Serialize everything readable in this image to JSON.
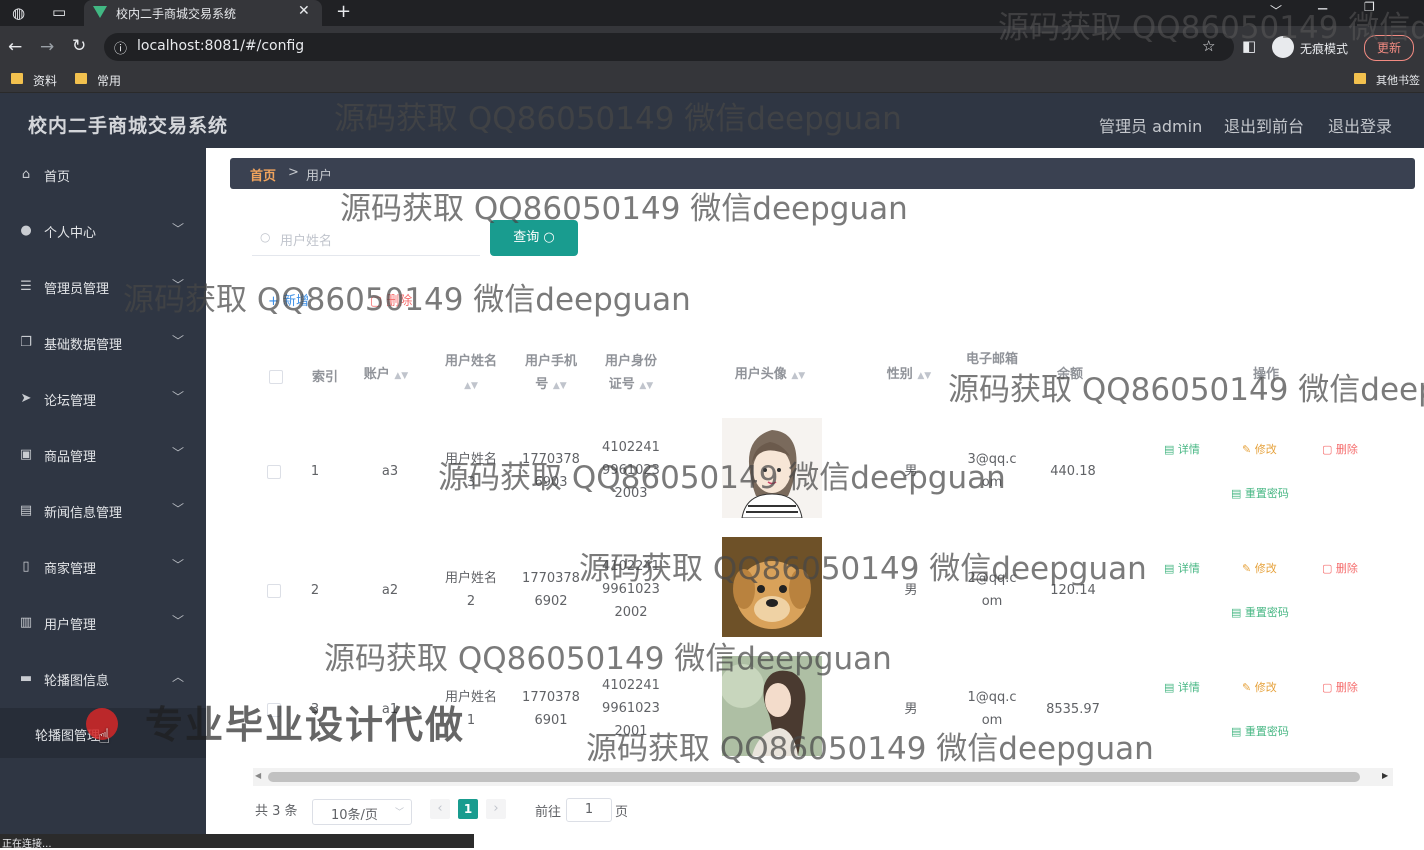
{
  "browser": {
    "tab_title": "校内二手商城交易系统",
    "url": "localhost:8081/#/config",
    "incognito_label": "无痕模式",
    "update_label": "更新",
    "bookmarks": [
      "资料",
      "常用"
    ],
    "other_bookmarks": "其他书签",
    "status_text": "正在连接..."
  },
  "app": {
    "title": "校内二手商城交易系统",
    "admin_label": "管理员 admin",
    "to_front_label": "退出到前台",
    "logout_label": "退出登录"
  },
  "sidebar": {
    "items": [
      {
        "label": "首页",
        "icon": "home-icon"
      },
      {
        "label": "个人中心",
        "icon": "user-icon",
        "arrow": "﹀"
      },
      {
        "label": "管理员管理",
        "icon": "list-icon",
        "arrow": "﹀"
      },
      {
        "label": "基础数据管理",
        "icon": "copy-icon",
        "arrow": "﹀"
      },
      {
        "label": "论坛管理",
        "icon": "send-icon",
        "arrow": "﹀"
      },
      {
        "label": "商品管理",
        "icon": "goods-icon",
        "arrow": "﹀"
      },
      {
        "label": "新闻信息管理",
        "icon": "news-icon",
        "arrow": "﹀"
      },
      {
        "label": "商家管理",
        "icon": "shop-icon",
        "arrow": "﹀"
      },
      {
        "label": "用户管理",
        "icon": "chart-icon",
        "arrow": "﹀"
      },
      {
        "label": "轮播图信息",
        "icon": "carousel-icon",
        "arrow": "︿"
      }
    ],
    "submenu_label": "轮播图管理"
  },
  "breadcrumb": {
    "home": "首页",
    "separator": ">",
    "current": "用户"
  },
  "search": {
    "placeholder": "用户姓名",
    "button_label": "查询"
  },
  "actions": {
    "add_label": "新增",
    "delete_label": "删除"
  },
  "table": {
    "headers": {
      "index": "索引",
      "account": "账户",
      "name_l1": "用户姓名",
      "phone_l1": "用户手机",
      "phone_l2": "号",
      "idcard_l1": "用户身份",
      "idcard_l2": "证号",
      "avatar": "用户头像",
      "gender": "性别",
      "email": "电子邮箱",
      "balance": "余额",
      "ops": "操作"
    },
    "rows": [
      {
        "index": "1",
        "account": "a3",
        "name_l1": "用户姓名",
        "name_l2": "3",
        "phone_l1": "1770378",
        "phone_l2": "6903",
        "id_l1": "4102241",
        "id_l2": "9961023",
        "id_l3": "2003",
        "gender": "男",
        "email_l1": "3@qq.c",
        "email_l2": "om",
        "balance": "440.18"
      },
      {
        "index": "2",
        "account": "a2",
        "name_l1": "用户姓名",
        "name_l2": "2",
        "phone_l1": "1770378",
        "phone_l2": "6902",
        "id_l1": "4102241",
        "id_l2": "9961023",
        "id_l3": "2002",
        "gender": "男",
        "email_l1": "2@qq.c",
        "email_l2": "om",
        "balance": "120.14"
      },
      {
        "index": "3",
        "account": "a1",
        "name_l1": "用户姓名",
        "name_l2": "1",
        "phone_l1": "1770378",
        "phone_l2": "6901",
        "id_l1": "4102241",
        "id_l2": "9961023",
        "id_l3": "2001",
        "gender": "男",
        "email_l1": "1@qq.c",
        "email_l2": "om",
        "balance": "8535.97"
      }
    ],
    "ops": {
      "detail": "详情",
      "edit": "修改",
      "delete": "删除",
      "reset": "重置密码"
    }
  },
  "pagination": {
    "total_label": "共 3 条",
    "page_size": "10条/页",
    "current_page": "1",
    "goto_label": "前往",
    "goto_value": "1",
    "page_suffix": "页"
  },
  "overlays": {
    "watermark": "源码获取 QQ86050149 微信deepguan",
    "watermark_cut": "源码获取 QQ86050149 微信de",
    "stamp": "专业毕业设计代做"
  }
}
